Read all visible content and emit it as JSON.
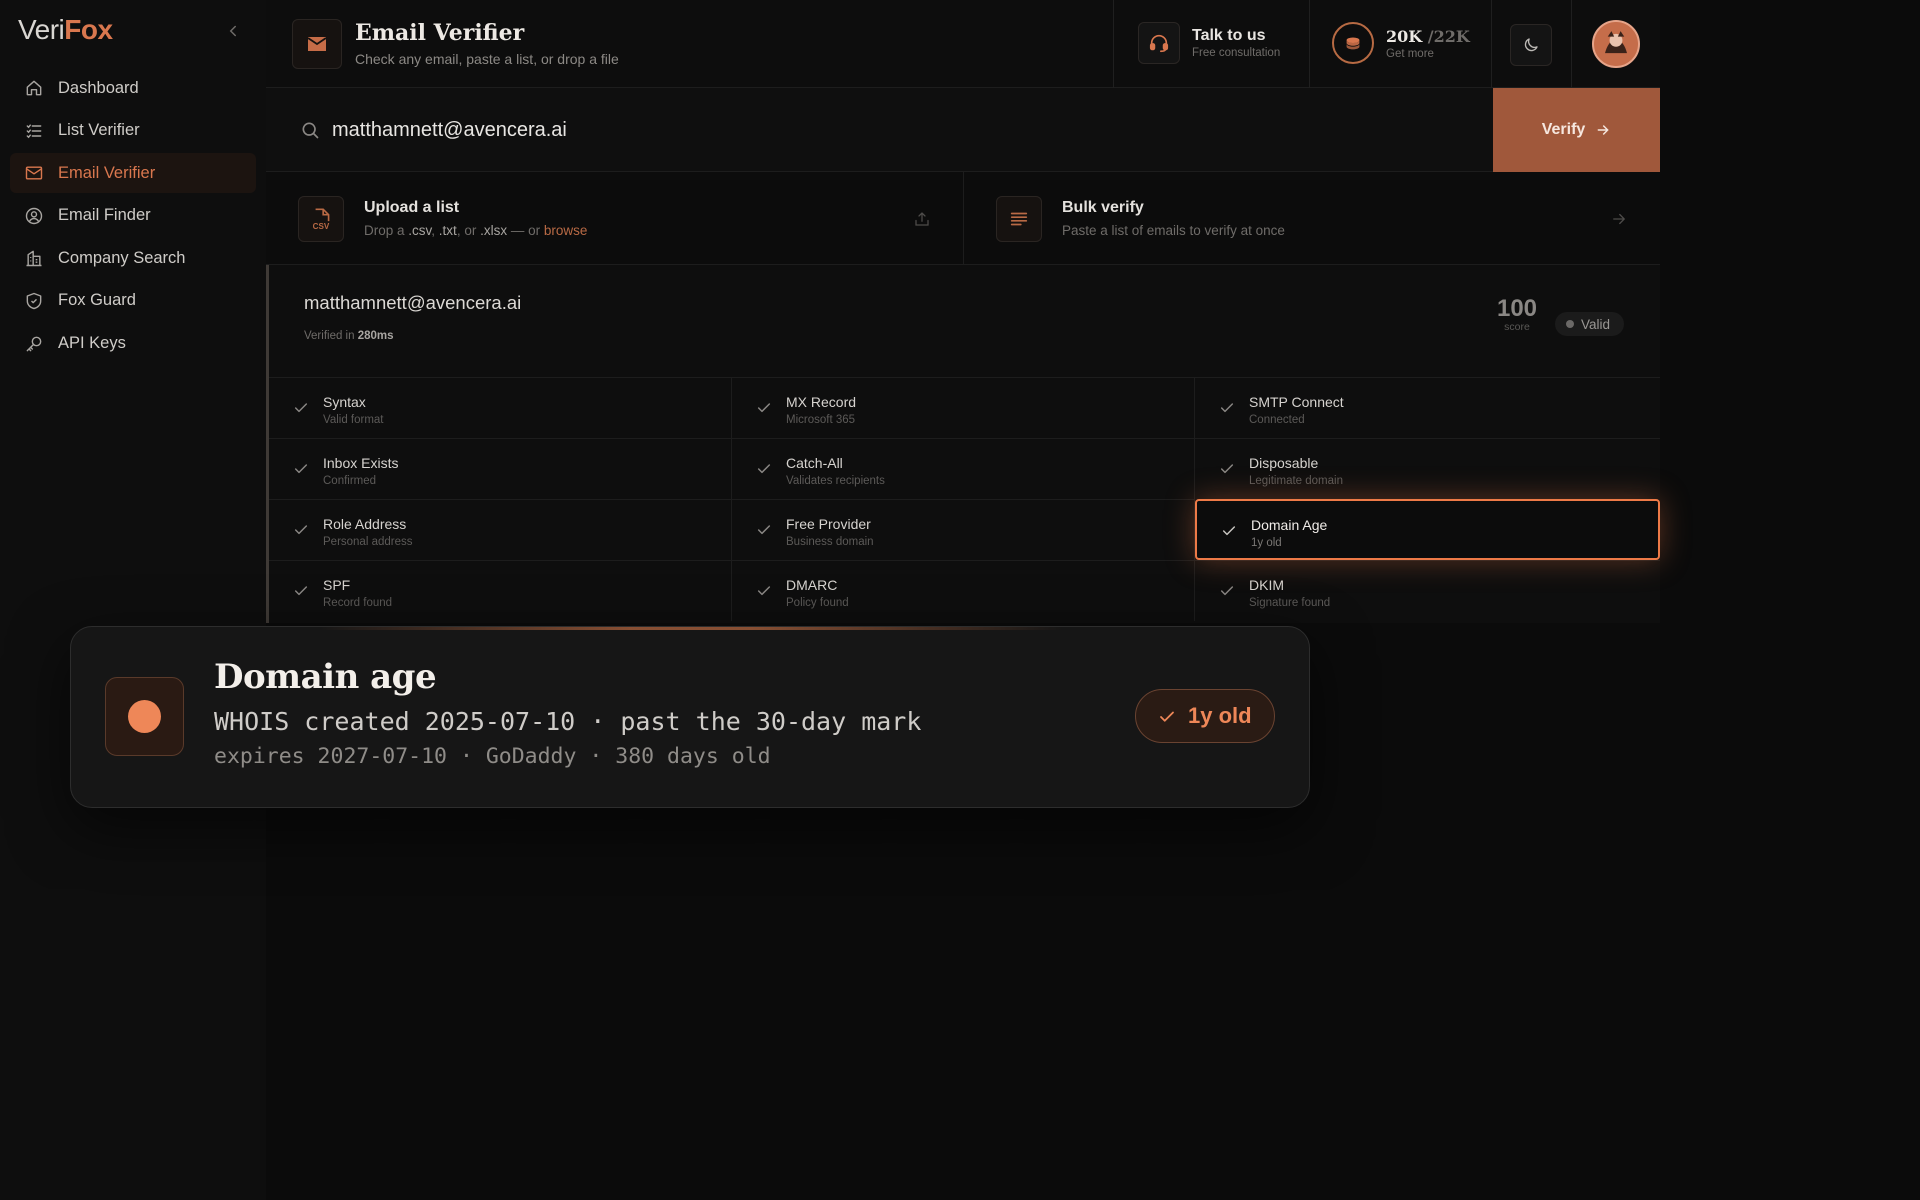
{
  "app": {
    "logo_part1": "Veri",
    "logo_part2": "Fox"
  },
  "sidebar": {
    "items": [
      {
        "label": "Dashboard",
        "icon": "home-icon"
      },
      {
        "label": "List Verifier",
        "icon": "list-icon"
      },
      {
        "label": "Email Verifier",
        "icon": "mail-icon",
        "active": true
      },
      {
        "label": "Email Finder",
        "icon": "user-search-icon"
      },
      {
        "label": "Company Search",
        "icon": "building-icon"
      },
      {
        "label": "Fox Guard",
        "icon": "shield-icon"
      },
      {
        "label": "API Keys",
        "icon": "key-icon"
      }
    ]
  },
  "header": {
    "title": "Email Verifier",
    "subtitle": "Check any email, paste a list, or drop a file",
    "talk_title": "Talk to us",
    "talk_sub": "Free consultation",
    "credits_used": "20K",
    "credits_total": "/22K",
    "credits_sub": "Get more"
  },
  "search": {
    "value": "matthamnett@avencera.ai",
    "button": "Verify"
  },
  "upload": {
    "title": "Upload a list",
    "desc_prefix": "Drop a ",
    "ext1": ".csv",
    "sep1": ", ",
    "ext2": ".txt",
    "sep2": ", or ",
    "ext3": ".xlsx",
    "desc_mid": " — or ",
    "browse": "browse",
    "csv_label": "CSV"
  },
  "bulk": {
    "title": "Bulk verify",
    "desc": "Paste a list of emails to verify at once"
  },
  "result": {
    "email": "matthamnett@avencera.ai",
    "time_prefix": "Verified in ",
    "time_value": "280ms",
    "score": "100",
    "score_label": "score",
    "status": "Valid",
    "checks": [
      {
        "title": "Syntax",
        "sub": "Valid format"
      },
      {
        "title": "MX Record",
        "sub": "Microsoft 365"
      },
      {
        "title": "SMTP Connect",
        "sub": "Connected"
      },
      {
        "title": "Inbox Exists",
        "sub": "Confirmed"
      },
      {
        "title": "Catch-All",
        "sub": "Validates recipients"
      },
      {
        "title": "Disposable",
        "sub": "Legitimate domain"
      },
      {
        "title": "Role Address",
        "sub": "Personal address"
      },
      {
        "title": "Free Provider",
        "sub": "Business domain"
      },
      {
        "title": "Domain Age",
        "sub": "1y old",
        "highlighted": true
      },
      {
        "title": "SPF",
        "sub": "Record found"
      },
      {
        "title": "DMARC",
        "sub": "Policy found"
      },
      {
        "title": "DKIM",
        "sub": "Signature found"
      }
    ]
  },
  "tooltip": {
    "title": "Domain age",
    "line1": "WHOIS created 2025-07-10 · past the 30-day mark",
    "line2": "expires 2027-07-10 · GoDaddy · 380 days old",
    "badge": "1y old"
  },
  "colors": {
    "accent": "#d9774e",
    "highlight": "#ee7a47",
    "verify_bg": "#a0583b"
  }
}
